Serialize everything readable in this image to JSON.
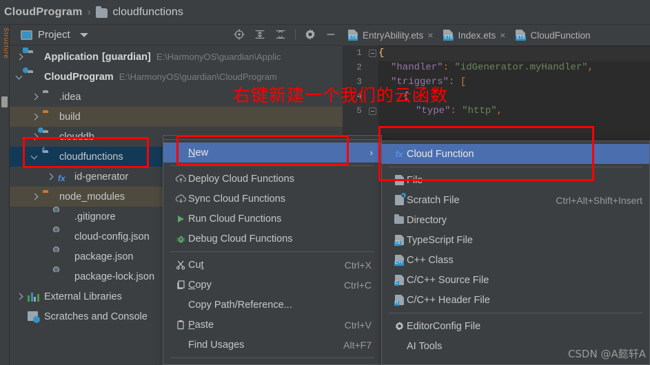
{
  "breadcrumb": {
    "project": "CloudProgram",
    "separator": "›",
    "folder": "cloudfunctions",
    "folder_icon": "folder-icon"
  },
  "project_panel": {
    "title": "Project",
    "title_icon": "project-window-icon",
    "dropdown_icon": "chevron-down-icon",
    "toolbar": [
      {
        "name": "select-opened-file-icon",
        "label": ""
      },
      {
        "name": "expand-all-icon",
        "label": ""
      },
      {
        "name": "collapse-all-icon",
        "label": ""
      },
      {
        "name": "settings-gear-icon",
        "label": ""
      },
      {
        "name": "hide-panel-icon",
        "label": ""
      }
    ],
    "tree": [
      {
        "label": "Application",
        "suffix": "[guardian]",
        "path": "E:\\HarmonyOS\\guardian\\Applic",
        "indent": 0,
        "arrow": "closed",
        "icon": "module-folder-icon",
        "bold": true,
        "state": "none"
      },
      {
        "label": "CloudProgram",
        "suffix": "",
        "path": "E:\\HarmonyOS\\guardian\\CloudProgram",
        "indent": 0,
        "arrow": "open",
        "icon": "cloud-module-folder-icon",
        "bold": true,
        "state": "none"
      },
      {
        "label": ".idea",
        "suffix": "",
        "path": "",
        "indent": 1,
        "arrow": "closed",
        "icon": "folder-icon",
        "bold": false,
        "state": "none"
      },
      {
        "label": "build",
        "suffix": "",
        "path": "",
        "indent": 1,
        "arrow": "closed",
        "icon": "excluded-folder-icon",
        "bold": false,
        "state": "gray"
      },
      {
        "label": "clouddb",
        "suffix": "",
        "path": "",
        "indent": 1,
        "arrow": "closed",
        "icon": "clouddb-folder-icon",
        "bold": false,
        "state": "none"
      },
      {
        "label": "cloudfunctions",
        "suffix": "",
        "path": "",
        "indent": 1,
        "arrow": "open",
        "icon": "cloudfunctions-folder-icon",
        "bold": false,
        "state": "blue"
      },
      {
        "label": "id-generator",
        "suffix": "",
        "path": "",
        "indent": 2,
        "arrow": "closed",
        "icon": "fx-icon",
        "bold": false,
        "state": "none"
      },
      {
        "label": "node_modules",
        "suffix": "",
        "path": "",
        "indent": 1,
        "arrow": "closed",
        "icon": "excluded-folder-icon",
        "bold": false,
        "state": "gray"
      },
      {
        "label": ".gitignore",
        "suffix": "",
        "path": "",
        "indent": 2,
        "arrow": "none",
        "icon": "gitignore-file-icon",
        "bold": false,
        "state": "none"
      },
      {
        "label": "cloud-config.json",
        "suffix": "",
        "path": "",
        "indent": 2,
        "arrow": "none",
        "icon": "json-file-icon",
        "bold": false,
        "state": "none"
      },
      {
        "label": "package.json",
        "suffix": "",
        "path": "",
        "indent": 2,
        "arrow": "none",
        "icon": "json-file-icon",
        "bold": false,
        "state": "none"
      },
      {
        "label": "package-lock.json",
        "suffix": "",
        "path": "",
        "indent": 2,
        "arrow": "none",
        "icon": "json-file-icon",
        "bold": false,
        "state": "none"
      },
      {
        "label": "External Libraries",
        "suffix": "",
        "path": "",
        "indent": 0,
        "arrow": "closed",
        "icon": "external-libraries-icon",
        "bold": false,
        "state": "none"
      },
      {
        "label": "Scratches and Console",
        "suffix": "",
        "path": "",
        "indent": 0,
        "arrow": "none",
        "icon": "scratches-icon",
        "bold": false,
        "state": "none"
      }
    ]
  },
  "editor": {
    "tabs": [
      {
        "label": "EntryAbility.ets",
        "icon": "ets-file-icon",
        "close": "×",
        "active": false
      },
      {
        "label": "Index.ets",
        "icon": "ets-file-icon",
        "close": "×",
        "active": false
      },
      {
        "label": "CloudFunction",
        "icon": "ets-file-icon",
        "close": "",
        "active": false
      }
    ],
    "line_numbers": [
      "1",
      "2",
      "3",
      "4",
      "5"
    ],
    "code_lines": [
      {
        "n": "1",
        "indent": 0,
        "tokens": [
          {
            "t": "{",
            "c": "brace"
          }
        ]
      },
      {
        "n": "2",
        "indent": 2,
        "tokens": [
          {
            "t": "\"handler\"",
            "c": "key"
          },
          {
            "t": ": ",
            "c": "punct"
          },
          {
            "t": "\"idGenerator.myHandler\"",
            "c": "str"
          },
          {
            "t": ",",
            "c": "punct"
          }
        ]
      },
      {
        "n": "3",
        "indent": 2,
        "tokens": [
          {
            "t": "\"triggers\"",
            "c": "key"
          },
          {
            "t": ": [",
            "c": "punct"
          }
        ]
      },
      {
        "n": "4",
        "indent": 4,
        "tokens": [
          {
            "t": "{",
            "c": "plain"
          }
        ]
      },
      {
        "n": "5",
        "indent": 6,
        "tokens": [
          {
            "t": "\"type\"",
            "c": "key"
          },
          {
            "t": ": ",
            "c": "punct"
          },
          {
            "t": "\"http\"",
            "c": "str"
          },
          {
            "t": ",",
            "c": "punct"
          }
        ]
      }
    ]
  },
  "context_menu": {
    "items": [
      {
        "label": "New",
        "mnemonic": "N",
        "icon": "",
        "shortcut": "",
        "arrow": "›",
        "highlighted": true,
        "separator_after": true
      },
      {
        "label": "Deploy Cloud Functions",
        "mnemonic": "",
        "icon": "cloud-upload-icon",
        "shortcut": "",
        "arrow": "",
        "highlighted": false,
        "separator_after": false
      },
      {
        "label": "Sync Cloud Functions",
        "mnemonic": "",
        "icon": "cloud-download-icon",
        "shortcut": "",
        "arrow": "",
        "highlighted": false,
        "separator_after": false
      },
      {
        "label": "Run Cloud Functions",
        "mnemonic": "",
        "icon": "run-play-icon",
        "shortcut": "",
        "arrow": "",
        "highlighted": false,
        "separator_after": false
      },
      {
        "label": "Debug Cloud Functions",
        "mnemonic": "",
        "icon": "debug-bug-icon",
        "shortcut": "",
        "arrow": "",
        "highlighted": false,
        "separator_after": true
      },
      {
        "label": "Cut",
        "mnemonic": "t",
        "icon": "scissors-icon",
        "shortcut": "Ctrl+X",
        "arrow": "",
        "highlighted": false,
        "separator_after": false
      },
      {
        "label": "Copy",
        "mnemonic": "C",
        "icon": "copy-icon",
        "shortcut": "Ctrl+C",
        "arrow": "",
        "highlighted": false,
        "separator_after": false
      },
      {
        "label": "Copy Path/Reference...",
        "mnemonic": "",
        "icon": "",
        "shortcut": "",
        "arrow": "",
        "highlighted": false,
        "separator_after": false
      },
      {
        "label": "Paste",
        "mnemonic": "P",
        "icon": "clipboard-icon",
        "shortcut": "Ctrl+V",
        "arrow": "",
        "highlighted": false,
        "separator_after": false
      },
      {
        "label": "Find Usages",
        "mnemonic": "",
        "icon": "",
        "shortcut": "Alt+F7",
        "arrow": "",
        "highlighted": false,
        "separator_after": true
      }
    ]
  },
  "submenu": {
    "items": [
      {
        "label": "Cloud Function",
        "icon": "fx-icon",
        "shortcut": "",
        "highlighted": true,
        "separator_after": true
      },
      {
        "label": "File",
        "icon": "file-icon",
        "shortcut": "",
        "highlighted": false,
        "separator_after": false
      },
      {
        "label": "Scratch File",
        "icon": "scratch-file-icon",
        "shortcut": "Ctrl+Alt+Shift+Insert",
        "highlighted": false,
        "separator_after": false
      },
      {
        "label": "Directory",
        "icon": "directory-icon",
        "shortcut": "",
        "highlighted": false,
        "separator_after": false
      },
      {
        "label": "TypeScript File",
        "icon": "typescript-file-icon",
        "shortcut": "",
        "highlighted": false,
        "separator_after": false
      },
      {
        "label": "C++ Class",
        "icon": "cpp-class-icon",
        "shortcut": "",
        "highlighted": false,
        "separator_after": false
      },
      {
        "label": "C/C++ Source File",
        "icon": "c-source-file-icon",
        "shortcut": "",
        "highlighted": false,
        "separator_after": false
      },
      {
        "label": "C/C++ Header File",
        "icon": "c-header-file-icon",
        "shortcut": "",
        "highlighted": false,
        "separator_after": true
      },
      {
        "label": "EditorConfig File",
        "icon": "editorconfig-gear-icon",
        "shortcut": "",
        "highlighted": false,
        "separator_after": false
      },
      {
        "label": "AI Tools",
        "icon": "",
        "shortcut": "",
        "highlighted": false,
        "separator_after": false
      }
    ]
  },
  "annotations": {
    "red_text": "右键新建一个我们的云函数",
    "red_color": "#fe0000",
    "boxes": [
      "cloudfunctions-tree-node",
      "new-menu-item",
      "cloud-function-submenu-item"
    ]
  },
  "watermark": "CSDN @A懿轩A",
  "colors": {
    "background": "#3c3f41",
    "editor_background": "#2b2b2b",
    "selection_blue": "#4b6eaf",
    "tree_selection": "#123a57",
    "accent_orange": "#cc7832",
    "accent_cyan": "#3592c4"
  }
}
